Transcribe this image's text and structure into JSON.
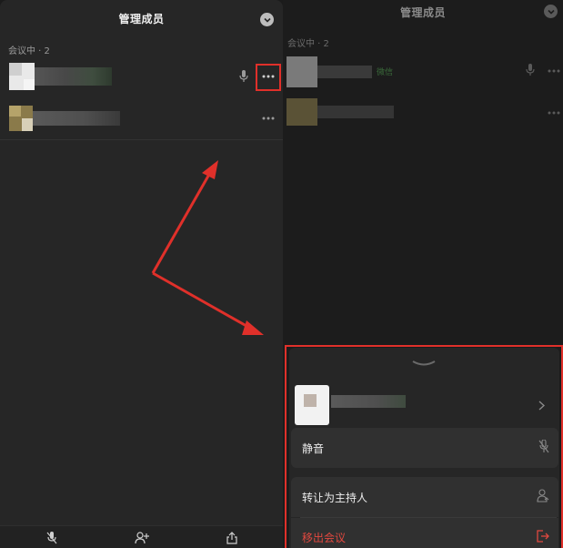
{
  "left": {
    "title": "管理成员",
    "section_label": "会议中 · 2",
    "toolbar_icons": [
      "mute-all-icon",
      "invite-member-icon",
      "share-icon"
    ]
  },
  "right": {
    "title": "管理成员",
    "section_label": "会议中 · 2",
    "member_tag": "微信",
    "sheet": {
      "actions": [
        {
          "label": "静音",
          "icon": "mic-muted-icon"
        },
        {
          "label": "转让为主持人",
          "icon": "host-transfer-icon"
        },
        {
          "label": "移出会议",
          "icon": "exit-icon",
          "danger": true
        }
      ]
    }
  },
  "colors": {
    "highlight": "#e0302a",
    "danger": "#e0483f",
    "tag_green": "#4a9b4a"
  }
}
